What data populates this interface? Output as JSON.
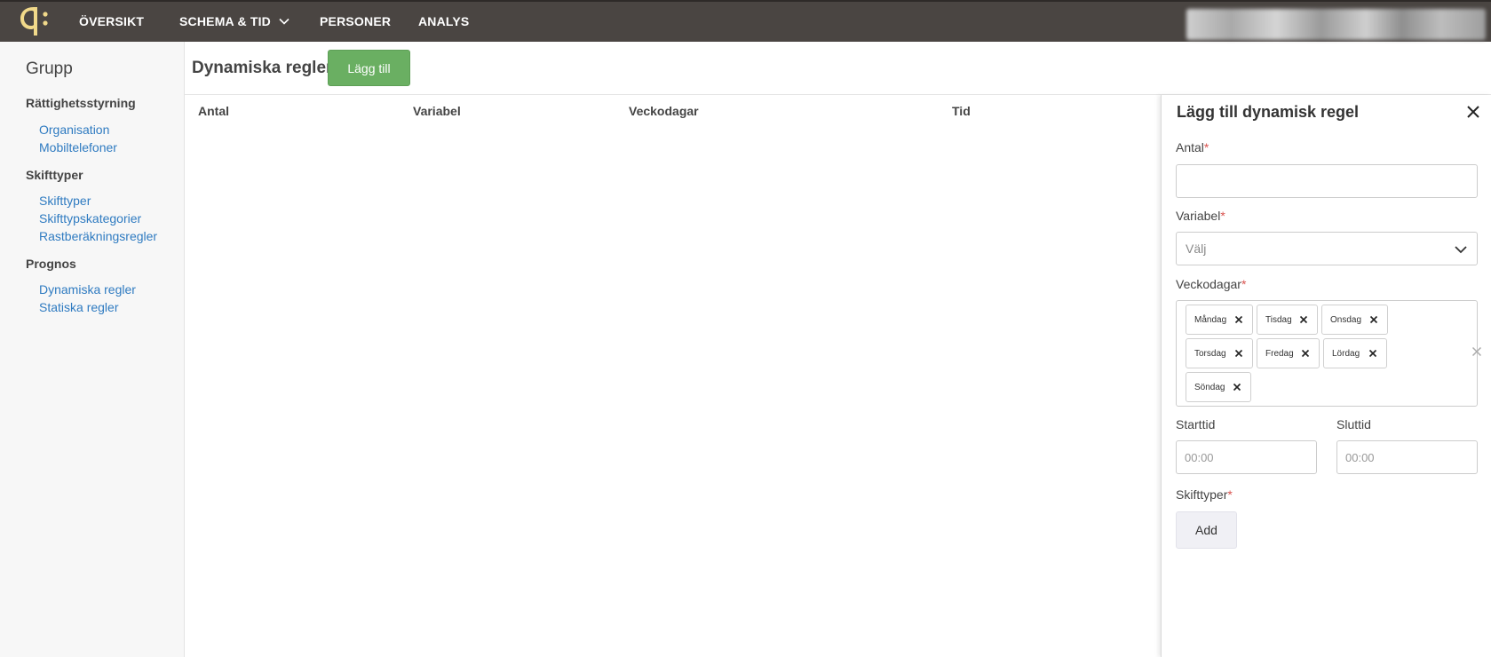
{
  "nav": {
    "items": [
      {
        "label": "ÖVERSIKT"
      },
      {
        "label": "SCHEMA & TID"
      },
      {
        "label": "PERSONER"
      },
      {
        "label": "ANALYS"
      }
    ],
    "logo_color": "#f1d98a"
  },
  "sidebar": {
    "title": "Grupp",
    "sections": [
      {
        "label": "Rättighetsstyrning",
        "links": [
          "Organisation",
          "Mobiltelefoner"
        ]
      },
      {
        "label": "Skifttyper",
        "links": [
          "Skifttyper",
          "Skifttypskategorier",
          "Rastberäkningsregler"
        ]
      },
      {
        "label": "Prognos",
        "links": [
          "Dynamiska regler",
          "Statiska regler"
        ]
      }
    ]
  },
  "main": {
    "title": "Dynamiska regler",
    "add_label": "Lägg till",
    "columns": [
      "Antal",
      "Variabel",
      "Veckodagar",
      "Tid"
    ]
  },
  "panel": {
    "title": "Lägg till dynamisk regel",
    "antal_label": "Antal",
    "antal_value": "",
    "variabel_label": "Variabel",
    "variabel_placeholder": "Välj",
    "veckodagar_label": "Veckodagar",
    "weekdays": [
      "Måndag",
      "Tisdag",
      "Onsdag",
      "Torsdag",
      "Fredag",
      "Lördag",
      "Söndag"
    ],
    "starttid_label": "Starttid",
    "starttid_placeholder": "00:00",
    "sluttid_label": "Sluttid",
    "sluttid_placeholder": "00:00",
    "skifttyper_label": "Skifttyper",
    "skifttyper_add": "Add",
    "required_mark": "*"
  },
  "colors": {
    "topbar": "#4a4542",
    "accent_green": "#6aaf62",
    "link_blue": "#2f7bc1",
    "required_red": "#d9534f"
  }
}
